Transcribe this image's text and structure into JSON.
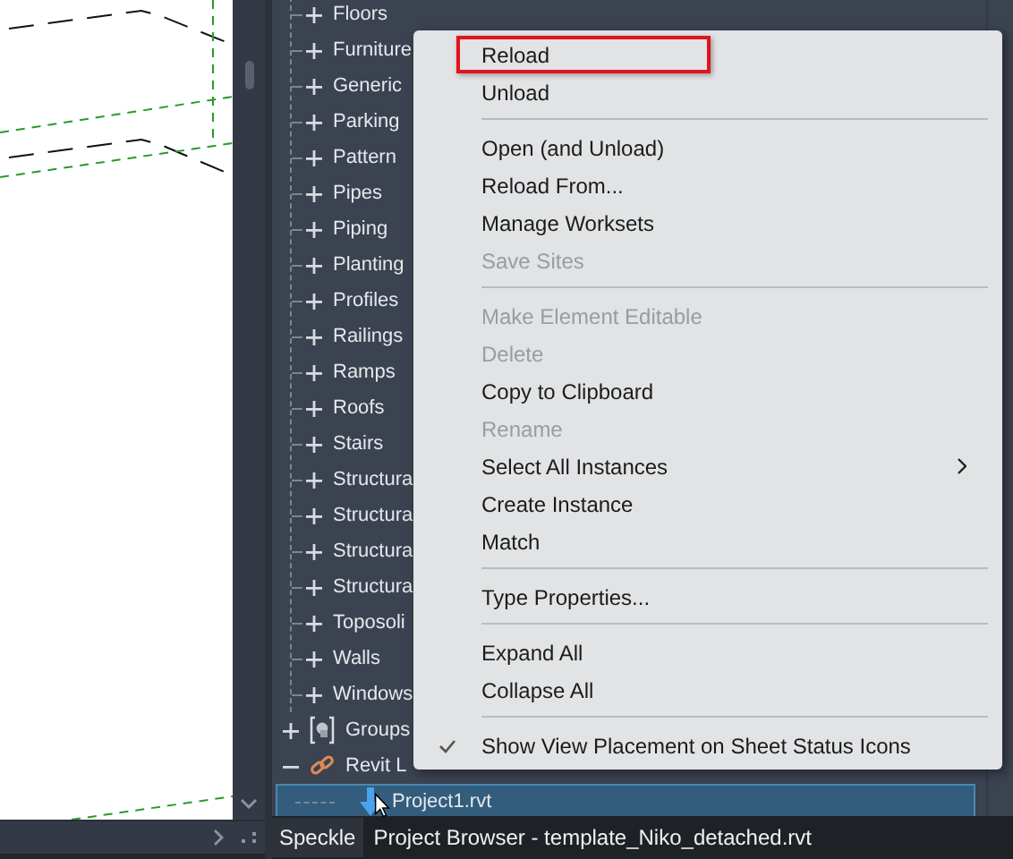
{
  "family_categories": [
    {
      "label": "Floors",
      "expanded": false
    },
    {
      "label": "Furniture",
      "expanded": false
    },
    {
      "label": "Generic",
      "expanded": false
    },
    {
      "label": "Parking",
      "expanded": false
    },
    {
      "label": "Pattern",
      "expanded": false
    },
    {
      "label": "Pipes",
      "expanded": false
    },
    {
      "label": "Piping",
      "expanded": false
    },
    {
      "label": "Planting",
      "expanded": false
    },
    {
      "label": "Profiles",
      "expanded": false
    },
    {
      "label": "Railings",
      "expanded": false
    },
    {
      "label": "Ramps",
      "expanded": false
    },
    {
      "label": "Roofs",
      "expanded": false
    },
    {
      "label": "Stairs",
      "expanded": false
    },
    {
      "label": "Structura",
      "expanded": false
    },
    {
      "label": "Structura",
      "expanded": false
    },
    {
      "label": "Structura",
      "expanded": false
    },
    {
      "label": "Structura",
      "expanded": false
    },
    {
      "label": "Toposoli",
      "expanded": false
    },
    {
      "label": "Walls",
      "expanded": false
    },
    {
      "label": "Windows",
      "expanded": false
    }
  ],
  "top_nodes": [
    {
      "label": "Groups",
      "kind": "groups",
      "expanded": false
    },
    {
      "label": "Revit L",
      "kind": "links",
      "expanded": true,
      "children": [
        {
          "label": "Project1.rvt",
          "selected": true
        }
      ]
    }
  ],
  "context_menu": [
    {
      "kind": "item",
      "label": "Reload",
      "disabled": false,
      "highlighted": true
    },
    {
      "kind": "item",
      "label": "Unload",
      "disabled": false
    },
    {
      "kind": "separator"
    },
    {
      "kind": "item",
      "label": "Open (and Unload)",
      "disabled": false
    },
    {
      "kind": "item",
      "label": "Reload From...",
      "disabled": false
    },
    {
      "kind": "item",
      "label": "Manage Worksets",
      "disabled": false
    },
    {
      "kind": "item",
      "label": "Save Sites",
      "disabled": true
    },
    {
      "kind": "separator"
    },
    {
      "kind": "item",
      "label": "Make Element Editable",
      "disabled": true
    },
    {
      "kind": "item",
      "label": "Delete",
      "disabled": true
    },
    {
      "kind": "item",
      "label": "Copy to Clipboard",
      "disabled": false
    },
    {
      "kind": "item",
      "label": "Rename",
      "disabled": true
    },
    {
      "kind": "item",
      "label": "Select All Instances",
      "disabled": false,
      "submenu": true
    },
    {
      "kind": "item",
      "label": "Create Instance",
      "disabled": false
    },
    {
      "kind": "item",
      "label": "Match",
      "disabled": false
    },
    {
      "kind": "separator"
    },
    {
      "kind": "item",
      "label": "Type Properties...",
      "disabled": false
    },
    {
      "kind": "separator"
    },
    {
      "kind": "item",
      "label": "Expand All",
      "disabled": false
    },
    {
      "kind": "item",
      "label": "Collapse All",
      "disabled": false
    },
    {
      "kind": "separator"
    },
    {
      "kind": "item",
      "label": "Show View Placement on Sheet Status Icons",
      "disabled": false,
      "checked": true
    }
  ],
  "bottom_tabs": [
    {
      "label": "Speckle",
      "selected": false
    },
    {
      "label": "Project Browser - template_Niko_detached.rvt",
      "selected": true
    }
  ]
}
